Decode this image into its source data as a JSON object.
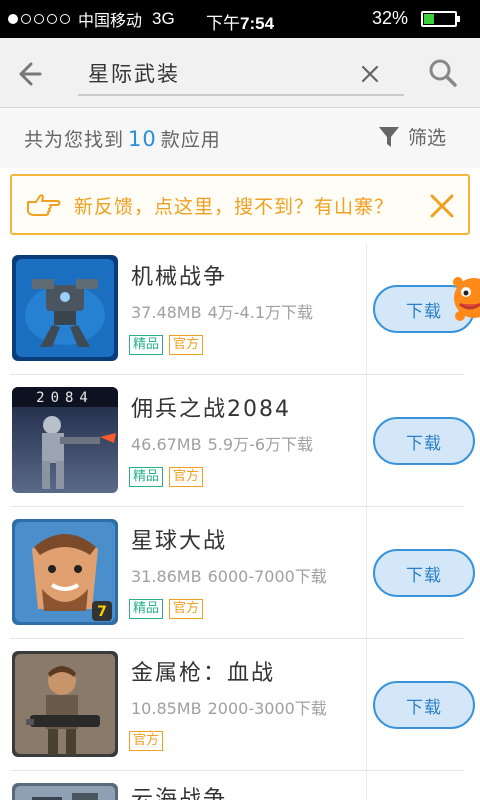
{
  "status_bar": {
    "carrier": "中国移动",
    "network": "3G",
    "time_prefix": "下午",
    "time": "7:54",
    "battery": "32%",
    "battery_level": 0.32,
    "signal_bars": 1
  },
  "header": {
    "search_value": "星际武装"
  },
  "result_bar": {
    "prefix": "共为您找到",
    "count": "10",
    "suffix": "款应用",
    "filter_label": "筛选"
  },
  "feedback": {
    "text": "新反馈，点这里，搜不到？有山寨？"
  },
  "apps": [
    {
      "name": "机械战争",
      "size": "37.48MB",
      "downloads": "4万-4.1万下载",
      "tags": [
        "精品",
        "官方"
      ],
      "button": "下载",
      "icon": "mech-war-icon"
    },
    {
      "name": "佣兵之战2084",
      "size": "46.67MB",
      "downloads": "5.9万-6万下载",
      "tags": [
        "精品",
        "官方"
      ],
      "button": "下载",
      "icon": "mercenary-2084-icon"
    },
    {
      "name": "星球大战",
      "size": "31.86MB",
      "downloads": "6000-7000下载",
      "tags": [
        "精品",
        "官方"
      ],
      "button": "下载",
      "icon": "planet-war-icon"
    },
    {
      "name": "金属枪：血战",
      "size": "10.85MB",
      "downloads": "2000-3000下载",
      "tags": [
        "官方"
      ],
      "button": "下载",
      "icon": "metal-gun-icon"
    }
  ],
  "partial_app": {
    "name": "云海战争"
  },
  "colors": {
    "accent": "#2a8fd6",
    "warning": "#f4b73c",
    "tag_green": "#27b08a",
    "tag_orange": "#f0a020"
  }
}
